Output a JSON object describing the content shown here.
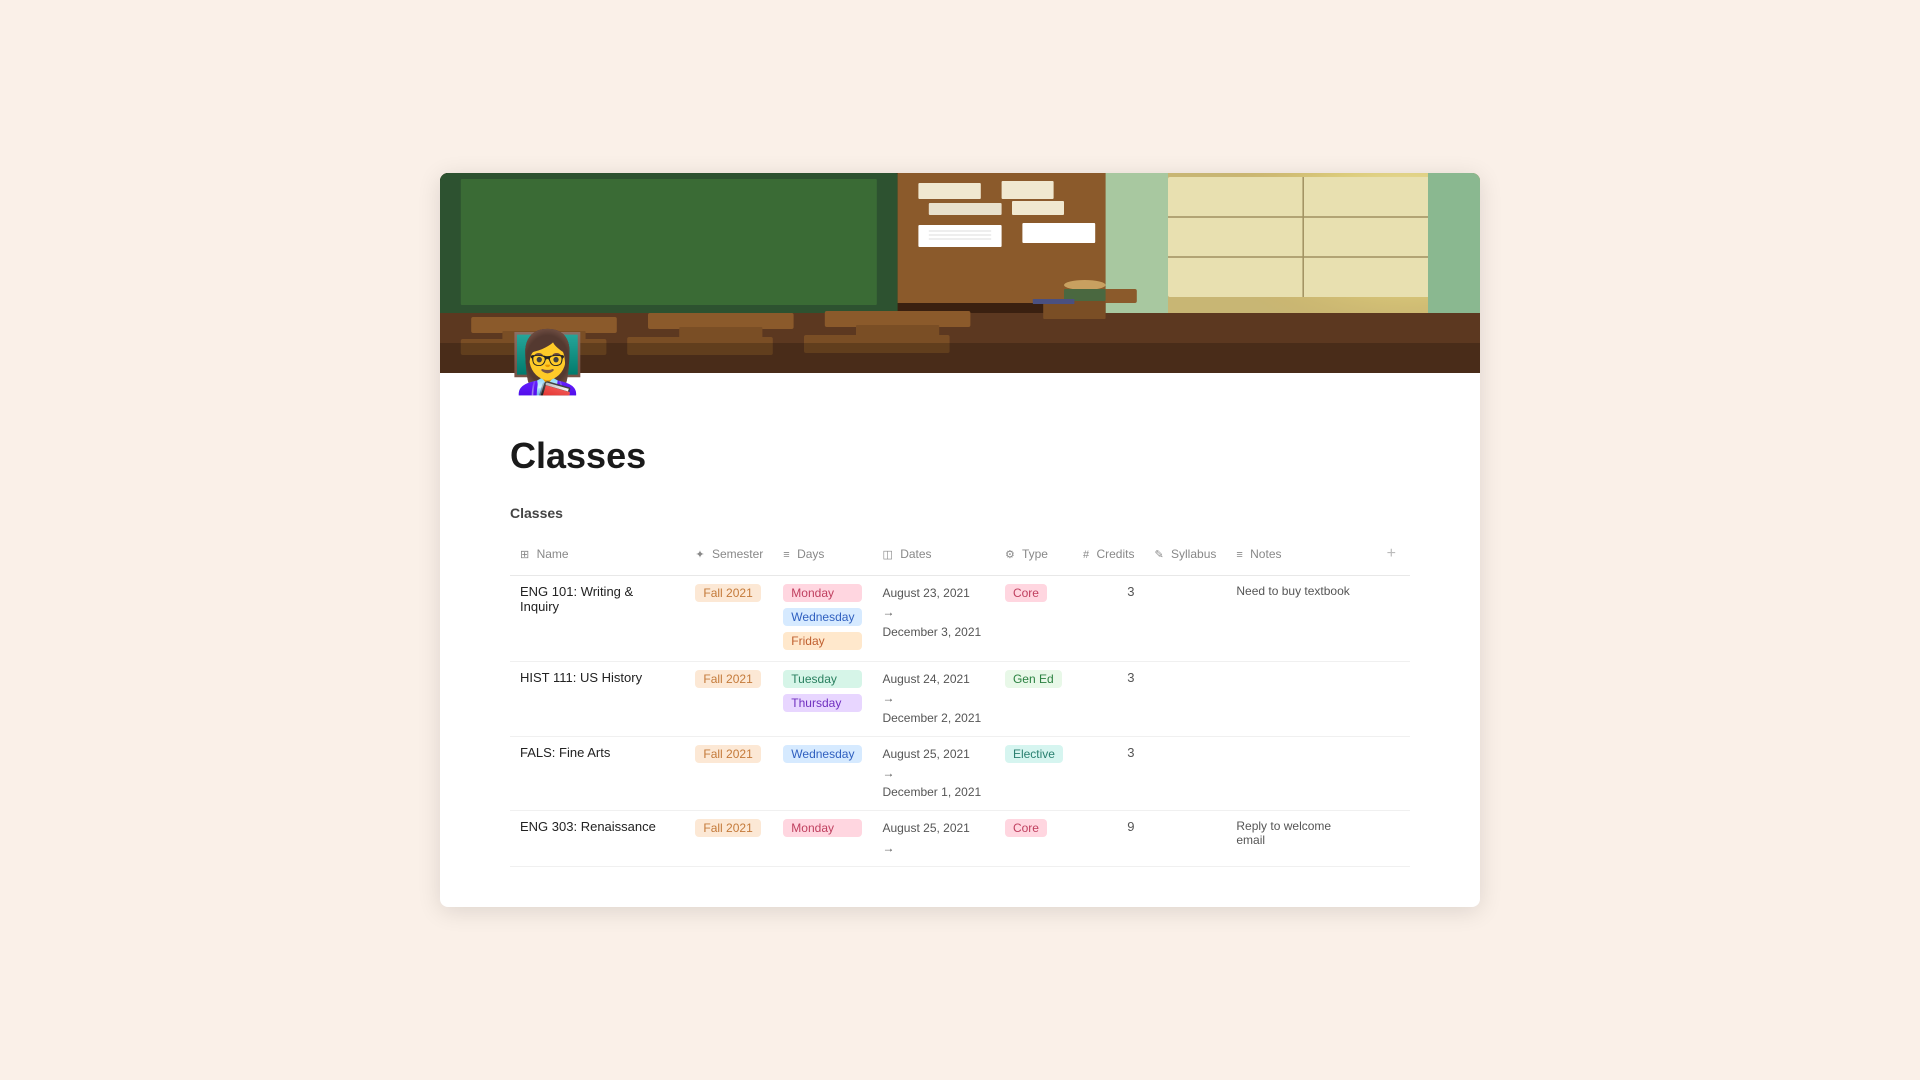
{
  "page": {
    "title": "Classes",
    "section_title": "Classes",
    "avatar_emoji": "👩‍🏫"
  },
  "columns": [
    {
      "id": "name",
      "icon": "⊞",
      "label": "Name"
    },
    {
      "id": "semester",
      "icon": "✦",
      "label": "Semester"
    },
    {
      "id": "days",
      "icon": "≡",
      "label": "Days"
    },
    {
      "id": "dates",
      "icon": "◫",
      "label": "Dates"
    },
    {
      "id": "type",
      "icon": "⚙",
      "label": "Type"
    },
    {
      "id": "credits",
      "icon": "#",
      "label": "Credits"
    },
    {
      "id": "syllabus",
      "icon": "✎",
      "label": "Syllabus"
    },
    {
      "id": "notes",
      "icon": "≡",
      "label": "Notes"
    }
  ],
  "rows": [
    {
      "name": "ENG 101: Writing & Inquiry",
      "semester": "Fall 2021",
      "days": [
        "Monday",
        "Wednesday",
        "Friday"
      ],
      "dates_start": "August 23, 2021 →",
      "dates_end": "December 3, 2021",
      "type": "Core",
      "credits": "3",
      "syllabus": "",
      "notes": "Need to buy textbook"
    },
    {
      "name": "HIST 111: US History",
      "semester": "Fall 2021",
      "days": [
        "Tuesday",
        "Thursday"
      ],
      "dates_start": "August 24, 2021 →",
      "dates_end": "December 2, 2021",
      "type": "Gen Ed",
      "credits": "3",
      "syllabus": "",
      "notes": ""
    },
    {
      "name": "FALS: Fine Arts",
      "semester": "Fall 2021",
      "days": [
        "Wednesday"
      ],
      "dates_start": "August 25, 2021 →",
      "dates_end": "December 1, 2021",
      "type": "Elective",
      "credits": "3",
      "syllabus": "",
      "notes": ""
    },
    {
      "name": "ENG 303: Renaissance",
      "semester": "Fall 2021",
      "days": [
        "Monday"
      ],
      "dates_start": "August 25, 2021 →",
      "dates_end": "",
      "type": "Core",
      "credits": "9",
      "syllabus": "",
      "notes": "Reply to welcome email"
    }
  ],
  "day_tag_classes": {
    "Monday": "tag-monday",
    "Tuesday": "tag-tuesday",
    "Wednesday": "tag-wednesday",
    "Thursday": "tag-thursday",
    "Friday": "tag-friday"
  },
  "type_tag_classes": {
    "Core": "tag-core",
    "Gen Ed": "tag-gened",
    "Elective": "tag-elective"
  }
}
